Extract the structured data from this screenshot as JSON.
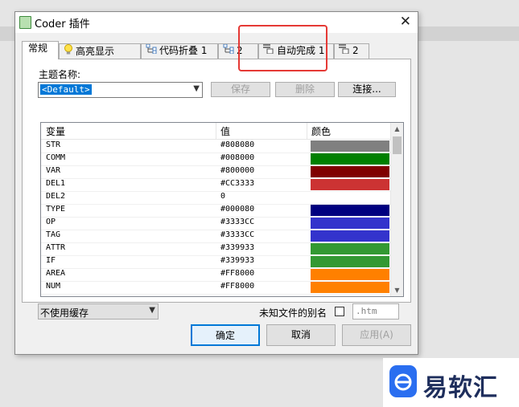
{
  "window": {
    "title": "Coder 插件",
    "close_glyph": "✕"
  },
  "tabs": [
    {
      "label": "常规",
      "icon": ""
    },
    {
      "label": "高亮显示",
      "icon": "bulb-icon"
    },
    {
      "label": "代码折叠 1",
      "icon": "fold-tree-icon"
    },
    {
      "label": "2",
      "icon": "fold-tree-icon"
    },
    {
      "label": "自动完成 1",
      "icon": "autocomplete-icon"
    },
    {
      "label": "2",
      "icon": "autocomplete-icon"
    }
  ],
  "theme": {
    "label": "主题名称:",
    "value": "<Default>",
    "save_label": "保存",
    "delete_label": "删除",
    "connect_label": "连接..."
  },
  "table": {
    "headers": [
      "变量",
      "值",
      "颜色"
    ],
    "rows": [
      {
        "name": "STR",
        "value": "#808080",
        "color": "#808080"
      },
      {
        "name": "COMM",
        "value": "#008000",
        "color": "#008000"
      },
      {
        "name": "VAR",
        "value": "#800000",
        "color": "#800000"
      },
      {
        "name": "DEL1",
        "value": "#CC3333",
        "color": "#CC3333"
      },
      {
        "name": "DEL2",
        "value": "0",
        "color": "#FFFFFF"
      },
      {
        "name": "TYPE",
        "value": "#000080",
        "color": "#000080"
      },
      {
        "name": "OP",
        "value": "#3333CC",
        "color": "#3333CC"
      },
      {
        "name": "TAG",
        "value": "#3333CC",
        "color": "#3333CC"
      },
      {
        "name": "ATTR",
        "value": "#339933",
        "color": "#339933"
      },
      {
        "name": "IF",
        "value": "#339933",
        "color": "#339933"
      },
      {
        "name": "AREA",
        "value": "#FF8000",
        "color": "#FF8000"
      },
      {
        "name": "NUM",
        "value": "#FF8000",
        "color": "#FF8000"
      }
    ]
  },
  "cache": {
    "value": "不使用缓存"
  },
  "alias": {
    "label": "未知文件的别名",
    "value": ".htm"
  },
  "footer": {
    "ok_label": "确定",
    "cancel_label": "取消",
    "apply_label": "应用(A)"
  },
  "watermark": {
    "text": "易软汇"
  }
}
